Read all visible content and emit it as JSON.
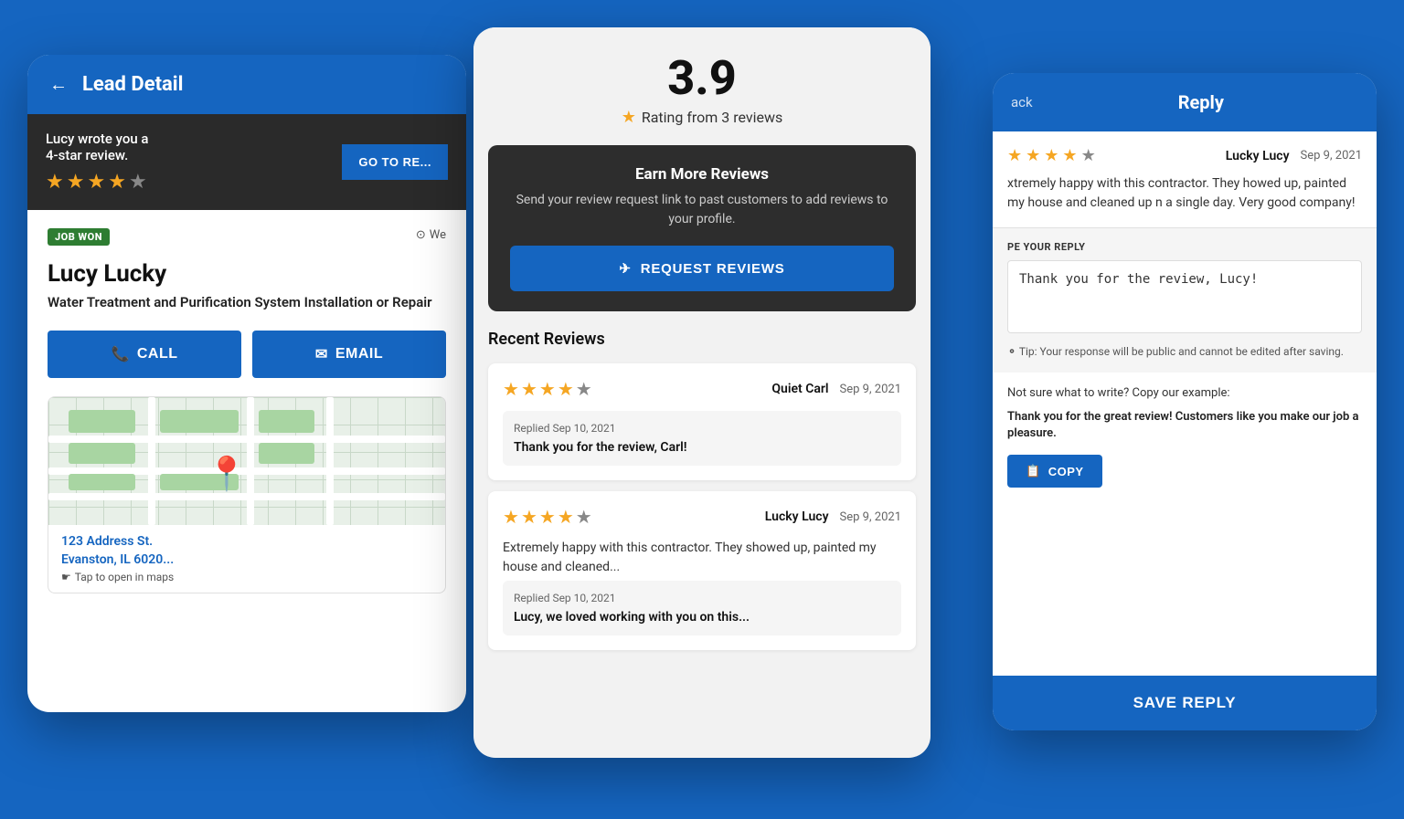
{
  "background_color": "#1565C0",
  "left_card": {
    "header": {
      "back_arrow": "←",
      "title": "Lead Detail"
    },
    "review_banner": {
      "text_line1": "Lucy wrote you a",
      "text_line2": "4-star review.",
      "go_to_review_btn": "GO TO RE...",
      "stars": [
        true,
        true,
        true,
        true,
        false
      ]
    },
    "lead": {
      "job_won_badge": "JOB WON",
      "we_label": "We",
      "name": "Lucy Lucky",
      "service": "Water Treatment and Purification System Installation or Repair",
      "call_btn": "CALL",
      "email_btn": "EMAIL"
    },
    "map": {
      "address_line1": "123 Address St.",
      "address_line2": "Evanston, IL 6020...",
      "tap_text": "Tap to open in maps"
    }
  },
  "center_card": {
    "rating": {
      "number": "3.9",
      "sub_text": "Rating from 3 reviews"
    },
    "earn_reviews": {
      "title": "Earn More Reviews",
      "description": "Send your review request link to past customers to add reviews to your profile.",
      "btn_label": "REQUEST REVIEWS"
    },
    "recent_reviews_title": "Recent Reviews",
    "reviews": [
      {
        "reviewer": "Quiet Carl",
        "date": "Sep 9, 2021",
        "stars": [
          true,
          true,
          true,
          true,
          false
        ],
        "has_reply": true,
        "reply_date": "Replied Sep 10, 2021",
        "reply_text": "Thank you for the review, Carl!"
      },
      {
        "reviewer": "Lucky Lucy",
        "date": "Sep 9, 2021",
        "stars": [
          true,
          true,
          true,
          true,
          false
        ],
        "body": "Extremely happy with this contractor. They showed up, painted my house and cleaned...",
        "has_reply": true,
        "reply_date": "Replied Sep 10, 2021",
        "reply_text": "Lucy, we loved working with you on this..."
      }
    ]
  },
  "right_card": {
    "header": {
      "back_text": "ack",
      "title": "Reply"
    },
    "review": {
      "reviewer": "Lucky Lucy",
      "date": "Sep 9, 2021",
      "stars": [
        true,
        true,
        true,
        true,
        false
      ],
      "body": "xtremely happy with this contractor. They howed up, painted my house and cleaned up n a single day. Very good company!"
    },
    "type_reply": {
      "label": "PE YOUR REPLY",
      "placeholder_value": "Thank you for the review, Lucy!"
    },
    "tip": "Tip: Your response will be public and cannot be edited after saving.",
    "example_label": "Not sure what to write? Copy our example:",
    "example_text": "Thank you for the great review! Customers like you make our job a pleasure.",
    "copy_btn": "COPY",
    "save_btn": "SAVE REPLY"
  }
}
